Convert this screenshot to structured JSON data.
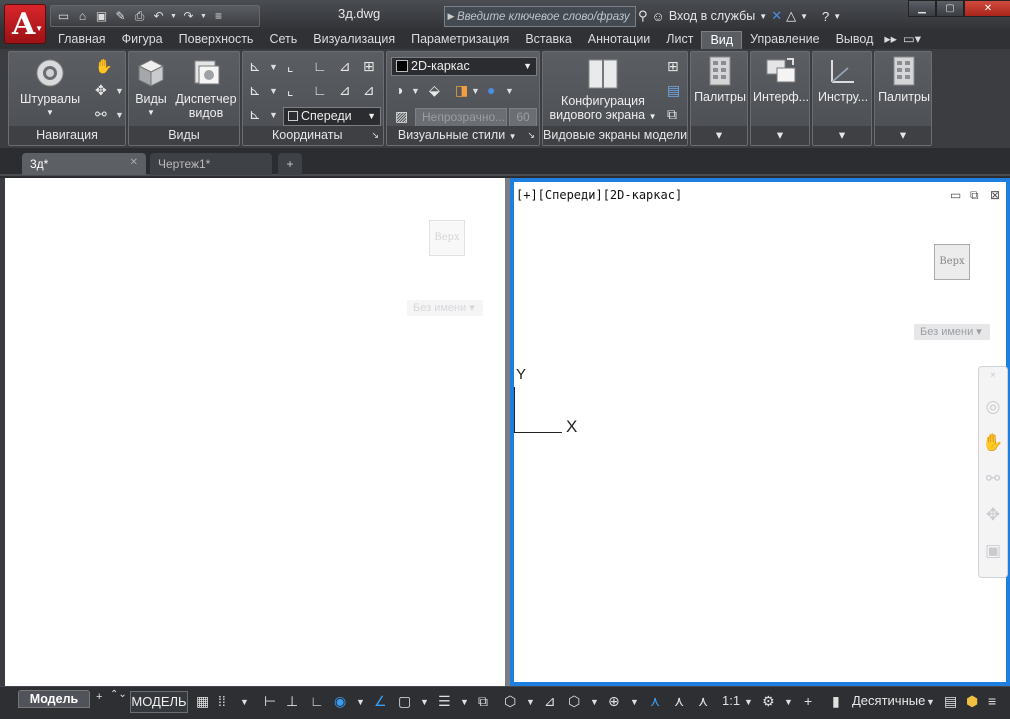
{
  "app": {
    "document_title": "3д.dwg",
    "search_placeholder": "Введите ключевое слово/фразу",
    "signin_label": "Вход в службы"
  },
  "ribbon_tabs": [
    {
      "label": "Главная"
    },
    {
      "label": "Фигура"
    },
    {
      "label": "Поверхность"
    },
    {
      "label": "Сеть"
    },
    {
      "label": "Визуализация"
    },
    {
      "label": "Параметризация"
    },
    {
      "label": "Вставка"
    },
    {
      "label": "Аннотации"
    },
    {
      "label": "Лист"
    },
    {
      "label": "Вид",
      "active": true
    },
    {
      "label": "Управление"
    },
    {
      "label": "Вывод"
    }
  ],
  "panels": {
    "navigation": {
      "title": "Навигация",
      "wheels_label": "Штурвалы"
    },
    "views": {
      "title": "Виды",
      "views_label": "Виды",
      "manager_line1": "Диспетчер",
      "manager_line2": "видов"
    },
    "coordinates": {
      "title": "Координаты",
      "view_select": "Спереди"
    },
    "visual_styles": {
      "title": "Визуальные стили",
      "style_select": "2D-каркас",
      "opacity_label": "Непрозрачно...",
      "opacity_value": "60"
    },
    "model_viewports": {
      "title": "Видовые экраны модели",
      "config_line1": "Конфигурация",
      "config_line2": "видового экрана"
    },
    "palettes": {
      "label": "Палитры"
    },
    "interface": {
      "label": "Интерф..."
    },
    "tools": {
      "label": "Инстру..."
    },
    "palettes2": {
      "label": "Палитры"
    }
  },
  "doc_tabs": [
    {
      "label": "3д*",
      "active": true
    },
    {
      "label": "Чертеж1*",
      "active": false
    }
  ],
  "viewport_right": {
    "label": "[+][Спереди][2D-каркас]",
    "viewcube_face": "Верх",
    "named_view": "Без имени",
    "ucs_x": "X",
    "ucs_y": "Y"
  },
  "viewport_left": {
    "viewcube_face": "Верх",
    "named_view": "Без имени"
  },
  "statusbar": {
    "model_tab": "Модель",
    "model_button": "МОДЕЛЬ",
    "scale": "1:1",
    "units": "Десятичные"
  },
  "colors": {
    "accent_viewport_border": "#1e7fe0",
    "app_button_red": "#c5181d",
    "ribbon_bg": "#4a4d51"
  }
}
